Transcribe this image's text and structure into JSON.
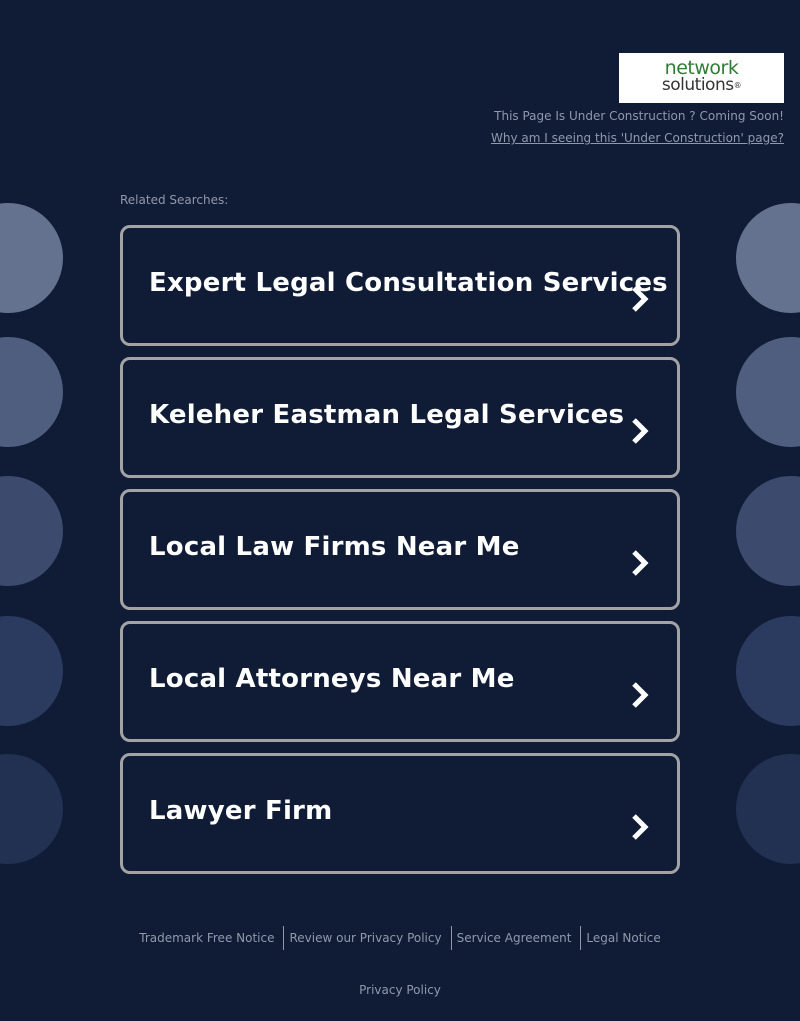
{
  "logo": {
    "line1": "network",
    "line2": "solutions",
    "reg_mark": "®"
  },
  "header": {
    "construction_text": "This Page Is Under Construction ? Coming Soon!",
    "construction_link": "Why am I seeing this 'Under Construction' page?"
  },
  "related": {
    "label": "Related Searches:",
    "items": [
      {
        "label": "Expert Legal Consultation Services"
      },
      {
        "label": "Keleher Eastman Legal Services"
      },
      {
        "label": "Local Law Firms Near Me"
      },
      {
        "label": "Local Attorneys Near Me"
      },
      {
        "label": "Lawyer Firm"
      }
    ]
  },
  "footer": {
    "links": [
      "Trademark Free Notice",
      "Review our Privacy Policy",
      "Service Agreement",
      "Legal Notice"
    ],
    "privacy": "Privacy Policy"
  },
  "colors": {
    "background": "#101c36",
    "box_border": "#a3a3a6",
    "muted_text": "#8f99ab",
    "logo_green": "#2e7d32"
  }
}
